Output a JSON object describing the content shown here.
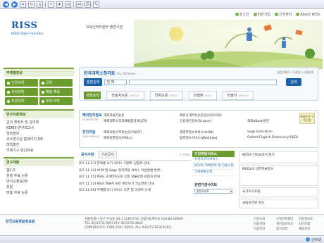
{
  "browser": {
    "status_text": "",
    "zone_label": "인터넷"
  },
  "util": [
    "로그인",
    "회원가입",
    "고객센터",
    "About RISS"
  ],
  "header": {
    "logo": "RISS",
    "logo_sub": "KERIS 학술연구정보서비스",
    "tagline": "교육인적자원부 출연기관"
  },
  "sidebar": {
    "sections": [
      {
        "title": "주제별정보",
        "buttons": [
          "인문과학",
          "사회과학",
          "자연과학",
          "예술·체육",
          "공학",
          "의학·약학"
        ]
      },
      {
        "title": "연구지원정보",
        "items": [
          "강의 계획서 및 강의록",
          "KERIS 연구보고서",
          "학회정보",
          "교수연구실 홈페이지 DB",
          "대학발간",
          "국제기구 발간자료"
        ]
      },
      {
        "title": "연구개발",
        "items": [
          "웹2.0",
          "현행 무료 논문",
          "바이오정보DB",
          "포탈",
          "맞춤 무료 논문"
        ]
      }
    ]
  },
  "search": {
    "title": "한국대학소장자료",
    "title_sub": "ALL Database",
    "links": "일반이용자 | 도움말 | 고급검색",
    "tab": "통합검색",
    "select_value": "전 체",
    "button": "검색",
    "cat_label": "개별검색",
    "categories": [
      {
        "label": "학술지논문",
        "sub": "ARTICLE"
      },
      {
        "label": "학위논문",
        "sub": "THESIS"
      },
      {
        "label": "단행본",
        "sub": "BOOK"
      },
      {
        "label": "학술지",
        "sub": "SERIALS"
      }
    ]
  },
  "foreign": {
    "label1": "해외전자정보",
    "label1_sub": "FOREIGN DB",
    "label2": "전자저널",
    "label2_sub": "NEW SERVICE",
    "row1": [
      "해외학술지논문",
      "해외공개학위논문원문(OCOD)",
      "해외대학소장자료통합검색(JCR)",
      "인용색인정보(Scopus)",
      "해외eBook원문"
    ],
    "row2": [
      "해외석박사학위논문(PQDT)",
      "경영학정보서비스(LION)",
      "해외법학정보(PMLL)",
      "법학정보서비스(WestLaw)",
      "Oxford English Dictionary(OED)"
    ],
    "row2b": "Sage Education",
    "trial": "해외논문 구독신청"
  },
  "notice": {
    "tabs": [
      "공지사항",
      "기관공지"
    ],
    "more": "+ 더보기",
    "items": [
      "[07.11.27] 한여름 보기 서비스 이벤트 당첨자 안내",
      "[07.11.23] ACM 및 Sage 전자저널 서비스 이용방법 변경...",
      "[07.11.15] RISS 고객만족도와 신청 실물운영 당첨자 안내",
      "[07.11.13] RISS 학술지 원문 원문보기 기능변경 안내",
      "[07.11.09] 주제별 보기 서비스 오픈 및 이벤트 안내"
    ]
  },
  "gift": {
    "title": "기관회원서비스",
    "items": [
      "사서도우미서비스",
      "KERIS 목록관리 및 전송시업",
      "기관원화신청"
    ],
    "related": "관련기관사이트",
    "related_select": "관련사이트"
  },
  "banners": [
    "KERIS 전자교과서 평가",
    "MEDLIS 의학학술정보",
    "국가지식포털",
    "국립보건원 정보"
  ],
  "footer": {
    "logo": "한국교육학술정보원",
    "address": [
      "서울특별시 중구 무교동 20-1 (100-170) 사업자등록번호 214-82-00999",
      "TEL 02)2278-7801 FAX 02)2278-4042",
      "COPYRIGHT© 1999-2007 KERIS. ALL RIGHTS RESERVED."
    ],
    "links": [
      "기관소개",
      "고객만족센터",
      "저작권보호",
      "이용안내",
      "개인정보보호",
      "사이트맵",
      "이용약관",
      "링크정책",
      "채용정보"
    ]
  }
}
